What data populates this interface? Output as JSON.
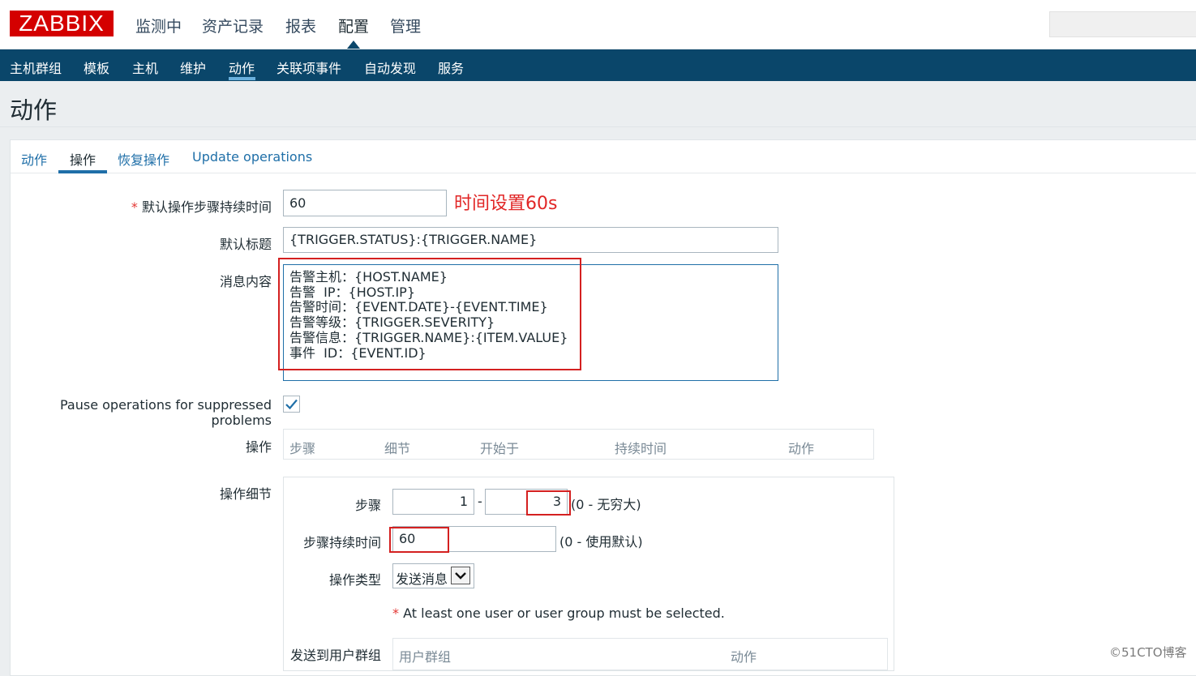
{
  "app": {
    "logo": "ZABBIX",
    "main_nav": [
      "监测中",
      "资产记录",
      "报表",
      "配置",
      "管理"
    ],
    "main_nav_active": "配置",
    "sub_nav": [
      "主机群组",
      "模板",
      "主机",
      "维护",
      "动作",
      "关联项事件",
      "自动发现",
      "服务"
    ],
    "sub_nav_active": "动作"
  },
  "page": {
    "title": "动作"
  },
  "tabs": [
    "动作",
    "操作",
    "恢复操作",
    "Update operations"
  ],
  "tabs_active": "操作",
  "form": {
    "step_duration_label": "默认操作步骤持续时间",
    "required_mark": "*",
    "step_duration_value": "60",
    "annotation": "时间设置60s",
    "subject_label": "默认标题",
    "subject_value": "{TRIGGER.STATUS}:{TRIGGER.NAME}",
    "message_label": "消息内容",
    "message_lines": [
      "告警主机：{HOST.NAME}",
      "告警  IP：{HOST.IP}",
      "告警时间：{EVENT.DATE}-{EVENT.TIME}",
      "告警等级：{TRIGGER.SEVERITY}",
      "告警信息：{TRIGGER.NAME}:{ITEM.VALUE}",
      "事件  ID：{EVENT.ID}"
    ],
    "pause_label": "Pause operations for suppressed problems",
    "pause_checked": true,
    "operations_label": "操作",
    "operations_columns": [
      "步骤",
      "细节",
      "开始于",
      "持续时间",
      "动作"
    ],
    "op_detail_label": "操作细节",
    "steps_label": "步骤",
    "steps_from": "1",
    "steps_separator": "-",
    "steps_to": "3",
    "steps_hint": "(0 - 无穷大)",
    "step_duration2_label": "步骤持续时间",
    "step_duration2_value": "60",
    "step_duration2_hint": "(0 - 使用默认)",
    "op_type_label": "操作类型",
    "op_type_value": "发送消息",
    "warning_text": "At least one user or user group must be selected.",
    "send_to_groups_label": "发送到用户群组",
    "usergroup_columns": [
      "用户群组",
      "动作"
    ]
  },
  "watermark": "©51CTO博客",
  "colors": {
    "brand_red": "#d40000",
    "nav_blue": "#0a466a",
    "link_blue": "#1f6fa8",
    "annotation_red": "#e12626"
  }
}
